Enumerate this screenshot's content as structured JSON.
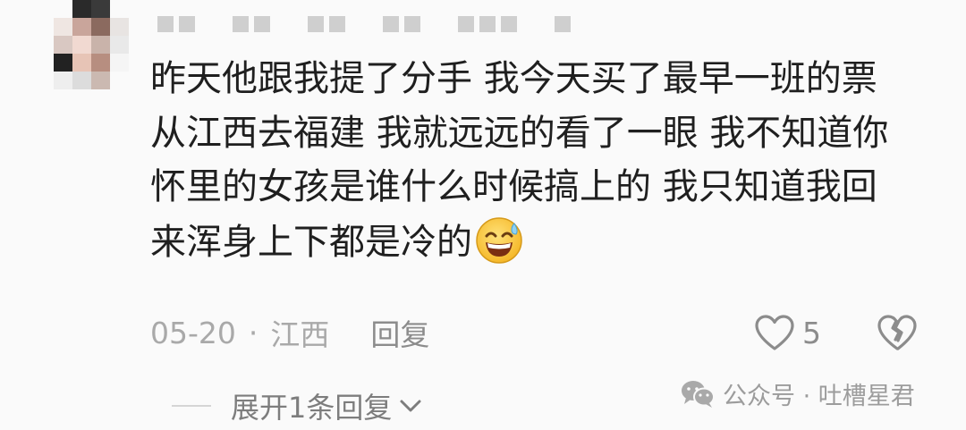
{
  "comment": {
    "lines": [
      "昨天他跟我提了分手  我今天买了最早一班的票",
      "从江西去福建 我就远远的看了一眼 我不知道你",
      "怀里的女孩是谁什么时候搞上的  我只知道我回",
      "来浑身上下都是冷的"
    ],
    "emoji": "grinning-sweat-emoji"
  },
  "meta": {
    "date": "05-20",
    "separator": "·",
    "location": "江西",
    "reply_label": "回复"
  },
  "actions": {
    "like_count": "5"
  },
  "replies": {
    "expand_label": "展开1条回复"
  },
  "watermark": {
    "text": "公众号 · 吐槽星君"
  },
  "colors": {
    "background": "#fafafa",
    "text": "#1f1f1f",
    "muted": "#a9a9a9"
  }
}
